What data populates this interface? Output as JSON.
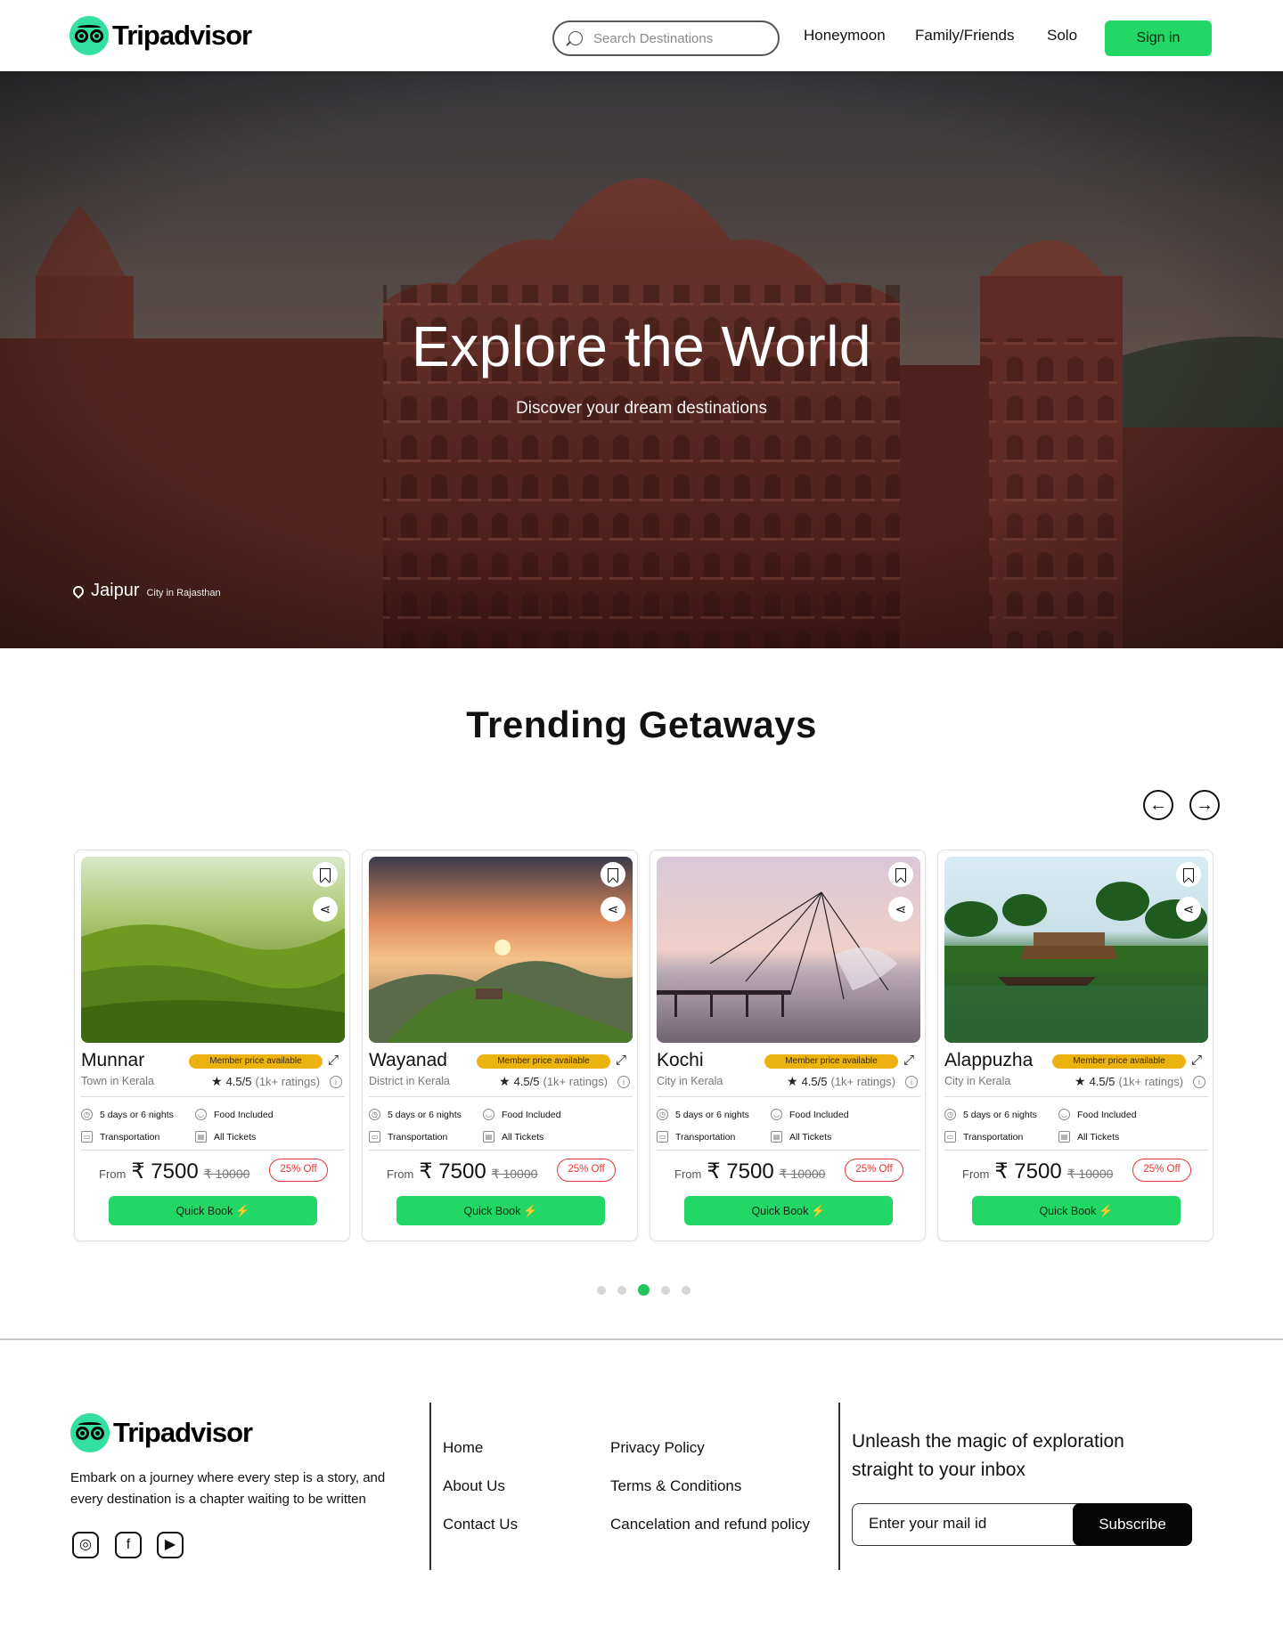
{
  "header": {
    "brand": "Tripadvisor",
    "search_placeholder": "Search Destinations",
    "nav": [
      "Honeymoon",
      "Family/Friends",
      "Solo"
    ],
    "signin_label": "Sign in"
  },
  "hero": {
    "title": "Explore the World",
    "subtitle": "Discover your dream destinations",
    "location_city": "Jaipur",
    "location_region": "City in Rajasthan"
  },
  "trending": {
    "title": "Trending Getaways",
    "prev_symbol": "←",
    "next_symbol": "→",
    "active_dot": 3,
    "dot_count": 5,
    "cards": [
      {
        "name": "Munnar",
        "type": "Town in Kerala",
        "badge": "Member price available",
        "rating": "4.5/5",
        "rating_count": "(1k+ ratings)",
        "feat_duration": "5 days or 6 nights",
        "feat_food": "Food Included",
        "feat_transport": "Transportation",
        "feat_tickets": "All Tickets",
        "from_label": "From",
        "price": "₹ 7500",
        "old_price": "₹ 10000",
        "discount": "25% Off",
        "cta": "Quick Book"
      },
      {
        "name": "Wayanad",
        "type": "District in Kerala",
        "badge": "Member price available",
        "rating": "4.5/5",
        "rating_count": "(1k+ ratings)",
        "feat_duration": "5 days or 6 nights",
        "feat_food": "Food Included",
        "feat_transport": "Transportation",
        "feat_tickets": "All Tickets",
        "from_label": "From",
        "price": "₹ 7500",
        "old_price": "₹ 10000",
        "discount": "25% Off",
        "cta": "Quick Book"
      },
      {
        "name": "Kochi",
        "type": "City in Kerala",
        "badge": "Member price available",
        "rating": "4.5/5",
        "rating_count": "(1k+ ratings)",
        "feat_duration": "5 days or 6 nights",
        "feat_food": "Food Included",
        "feat_transport": "Transportation",
        "feat_tickets": "All Tickets",
        "from_label": "From",
        "price": "₹ 7500",
        "old_price": "₹ 10000",
        "discount": "25% Off",
        "cta": "Quick Book"
      },
      {
        "name": "Alappuzha",
        "type": "City in Kerala",
        "badge": "Member price available",
        "rating": "4.5/5",
        "rating_count": "(1k+ ratings)",
        "feat_duration": "5 days or 6 nights",
        "feat_food": "Food Included",
        "feat_transport": "Transportation",
        "feat_tickets": "All Tickets",
        "from_label": "From",
        "price": "₹ 7500",
        "old_price": "₹ 10000",
        "discount": "25% Off",
        "cta": "Quick Book"
      }
    ]
  },
  "footer": {
    "brand": "Tripadvisor",
    "description": "Embark on a journey where every step is a story, and every destination is a chapter waiting to be written",
    "social_icons": [
      "instagram-icon",
      "facebook-icon",
      "youtube-icon"
    ],
    "links_col1": [
      "Home",
      "About Us",
      "Contact Us"
    ],
    "links_col2": [
      "Privacy Policy",
      "Terms & Conditions",
      "Cancelation and refund policy"
    ],
    "newsletter_text": "Unleash the magic of exploration straight to your inbox",
    "email_placeholder": "Enter your mail id",
    "subscribe_label": "Subscribe"
  },
  "colors": {
    "brand_green": "#34e0a1",
    "cta_green": "#22d765",
    "badge_yellow": "#ecb20f",
    "discount_red": "#e53535",
    "dot_active": "#22c55e"
  }
}
